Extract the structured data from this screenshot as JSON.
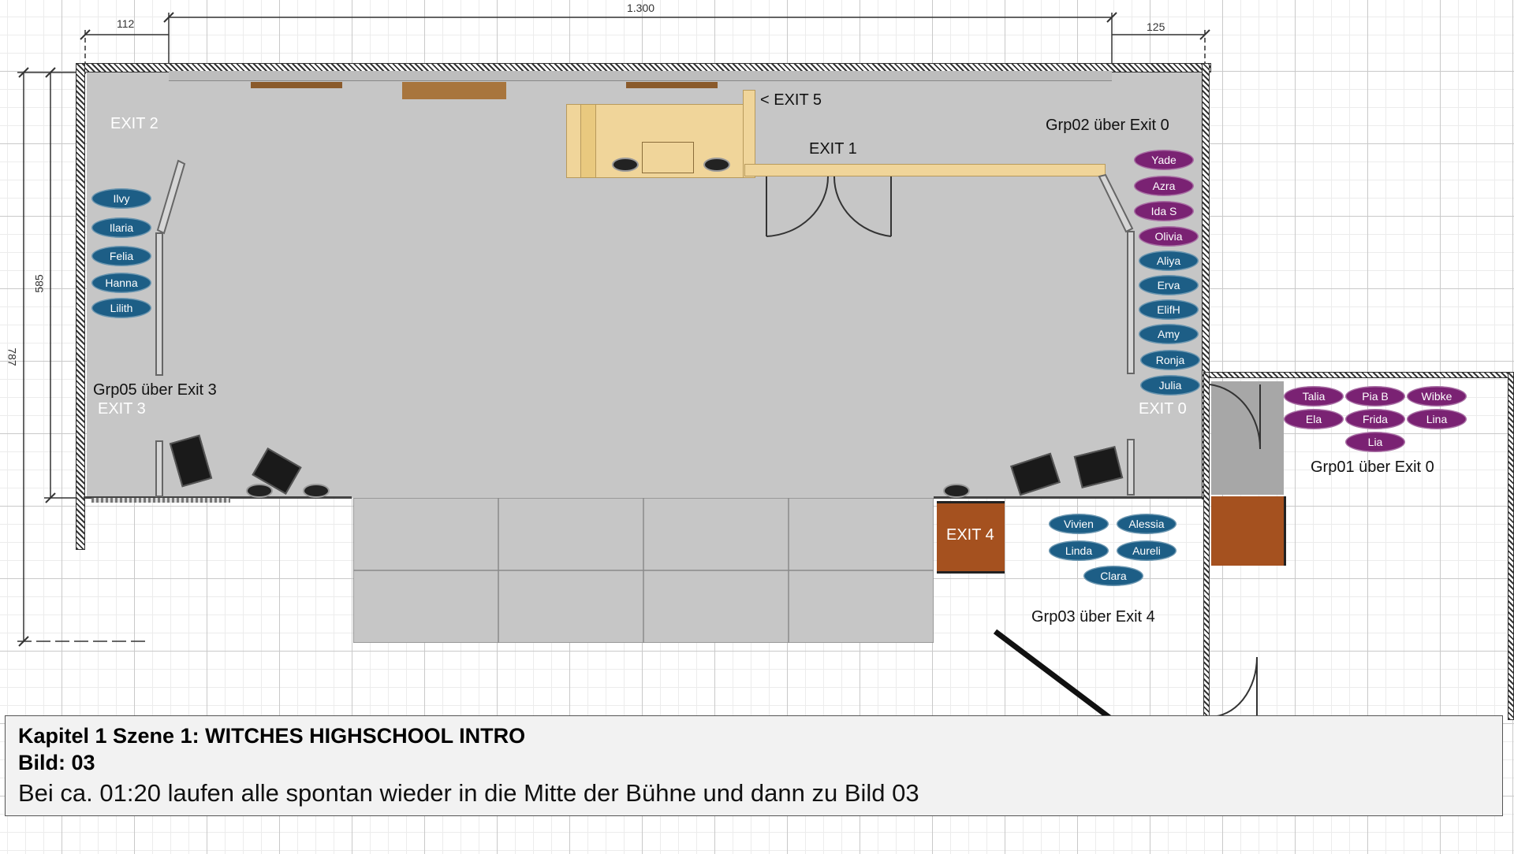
{
  "dimensions": {
    "top_total": "1.300",
    "top_left": "112",
    "top_right": "125",
    "side_inner": "585",
    "side_outer": "787"
  },
  "exits": {
    "exit2": "EXIT 2",
    "exit3": "EXIT 3",
    "exit0": "EXIT 0",
    "exit1": "EXIT 1",
    "exit5": "< EXIT 5",
    "exit4": "EXIT 4"
  },
  "groups": {
    "grp02": "Grp02 über Exit 0",
    "grp05": "Grp05 über Exit 3",
    "grp01": "Grp01 über Exit 0",
    "grp03": "Grp03 über Exit 4"
  },
  "actors": {
    "left_column": [
      "Ilvy",
      "Ilaria",
      "Felia",
      "Hanna",
      "Lilith"
    ],
    "right_column_purple": [
      "Yade",
      "Azra",
      "Ida S",
      "Olivia"
    ],
    "right_column_blue": [
      "Aliya",
      "Erva",
      "ElifH",
      "Amy",
      "Ronja",
      "Julia"
    ],
    "grp01": [
      "Talia",
      "Pia B",
      "Wibke",
      "Ela",
      "Frida",
      "Lina",
      "Lia"
    ],
    "grp03": [
      "Vivien",
      "Alessia",
      "Linda",
      "Aureli",
      "Clara"
    ]
  },
  "colors": {
    "blue_actor": "#1d5e86",
    "purple_actor": "#7a2273",
    "stage": "#c6c6c6",
    "exit4_door": "#a5511f"
  },
  "caption": {
    "line1": "Kapitel 1 Szene 1: WITCHES HIGHSCHOOL INTRO",
    "line2": "Bild: 03",
    "line3": "Bei ca. 01:20 laufen alle spontan wieder in die Mitte der Bühne und dann zu Bild 03"
  }
}
